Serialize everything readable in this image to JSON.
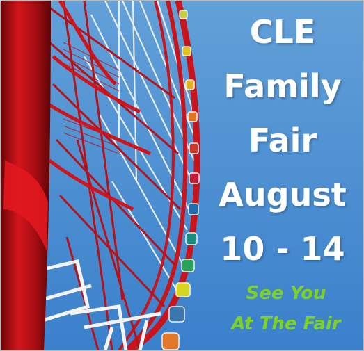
{
  "poster": {
    "lines": [
      "CLE",
      "Family",
      "Fair",
      "August",
      "10 - 14"
    ],
    "tagline": [
      "See You",
      "At The Fair"
    ]
  },
  "colors": {
    "sky": "#4b8dd0",
    "wheel_red": "#c8141a",
    "headline": "#ffffff",
    "tagline": "#7ed321"
  }
}
